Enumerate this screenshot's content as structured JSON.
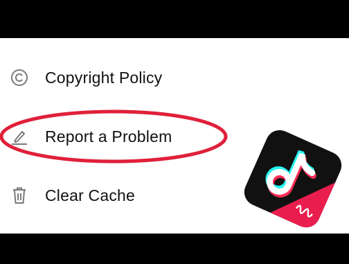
{
  "menu": {
    "items": [
      {
        "label": "Copyright Policy",
        "icon": "copyright-icon"
      },
      {
        "label": "Report a Problem",
        "icon": "pencil-icon"
      },
      {
        "label": "Clear Cache",
        "icon": "trash-icon"
      }
    ]
  },
  "colors": {
    "highlight": "#e0203a",
    "icon_gray": "#7a7a7a",
    "logo_bg": "#111111",
    "logo_red": "#e91e4f",
    "logo_cyan": "#25f4ee"
  }
}
